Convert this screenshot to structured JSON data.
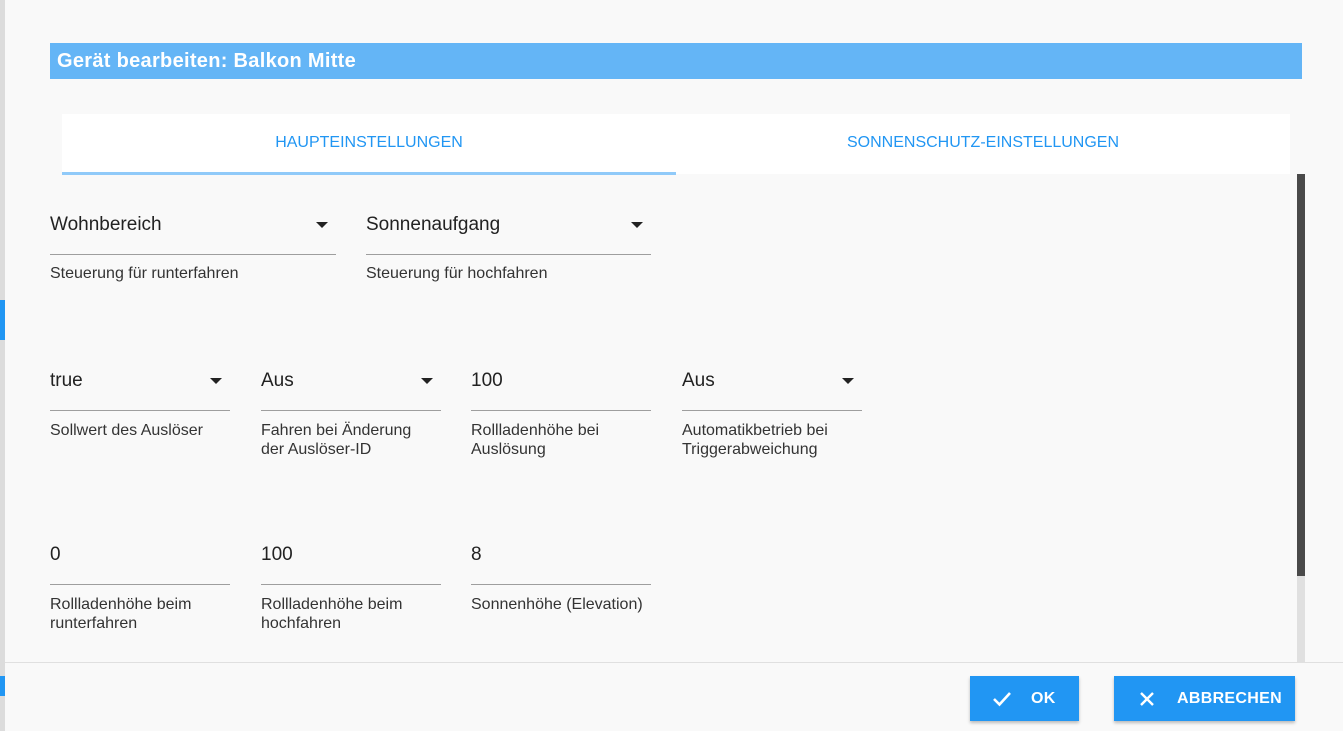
{
  "dialog": {
    "title": "Gerät bearbeiten: Balkon Mitte"
  },
  "tabs": [
    {
      "label": "HAUPTEINSTELLUNGEN",
      "active": true
    },
    {
      "label": "SONNENSCHUTZ-EINSTELLUNGEN",
      "active": false
    }
  ],
  "fields": {
    "down_control": {
      "value": "Wohnbereich",
      "label": "Steuerung für runterfahren"
    },
    "up_control": {
      "value": "Sonnenaufgang",
      "label": "Steuerung für hochfahren"
    },
    "trigger_setpoint": {
      "value": "true",
      "label": "Sollwert des Auslöser"
    },
    "drive_on_change": {
      "value": "Aus",
      "label_line1": "Fahren bei Änderung",
      "label_line2": "der Auslöser-ID"
    },
    "height_on_trigger": {
      "value": "100",
      "label_line1": "Rollladenhöhe bei",
      "label_line2": "Auslösung"
    },
    "auto_on_deviation": {
      "value": "Aus",
      "label_line1": "Automatikbetrieb bei",
      "label_line2": "Triggerabweichung"
    },
    "height_down": {
      "value": "0",
      "label_line1": "Rollladenhöhe beim",
      "label_line2": "runterfahren"
    },
    "height_up": {
      "value": "100",
      "label_line1": "Rollladenhöhe beim",
      "label_line2": "hochfahren"
    },
    "elevation": {
      "value": "8",
      "label": "Sonnenhöhe (Elevation)"
    }
  },
  "buttons": {
    "ok": "OK",
    "cancel": "ABBRECHEN"
  },
  "colors": {
    "accent": "#2196f3",
    "title_bar": "#64b5f6"
  }
}
